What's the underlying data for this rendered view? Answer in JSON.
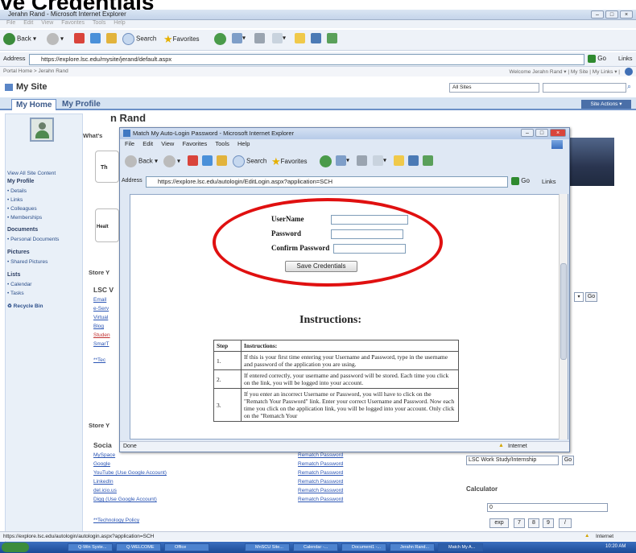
{
  "slide": {
    "title": "ve Credentials"
  },
  "main_window": {
    "title": "Jerahn Rand - Microsoft Internet Explorer",
    "menu": [
      "File",
      "Edit",
      "View",
      "Favorites",
      "Tools",
      "Help"
    ],
    "toolbar": {
      "back": "Back",
      "search": "Search",
      "favorites": "Favorites"
    },
    "address_label": "Address",
    "address": "https://explore.lsc.edu/mysite/jerand/default.aspx",
    "go": "Go",
    "links": "Links",
    "breadcrumb": "Portal Home > Jerahn Rand",
    "welcome": "Welcome Jerahn Rand ▾ | My Site | My Links ▾ |",
    "site_title": "My Site",
    "scope": "All Sites",
    "tabs": [
      "My Home",
      "My Profile"
    ],
    "site_actions": "Site Actions ▾",
    "status_url": "https://explore.lsc.edu/autologin/autologin.aspx?application=SCH",
    "status_zone": "Internet"
  },
  "left_nav": {
    "view_all": "View All Site Content",
    "sections": [
      {
        "heading": "My Profile",
        "items": [
          "Details",
          "Links",
          "Colleagues",
          "Memberships"
        ]
      },
      {
        "heading": "Documents",
        "items": [
          "Personal Documents"
        ]
      },
      {
        "heading": "Pictures",
        "items": [
          "Shared Pictures"
        ]
      },
      {
        "heading": "Lists",
        "items": [
          "Calendar",
          "Tasks"
        ]
      }
    ],
    "recycle_bin": "Recycle Bin"
  },
  "center": {
    "name_partial": "n Rand",
    "whats": "What's",
    "store1": "Store Y",
    "lsc": "LSC V",
    "links_partial": [
      "Email",
      "e-Serv",
      "Virtual",
      "Blog",
      "Studen",
      "SmarT"
    ],
    "tech_partial": "**Tec",
    "store2": "Store Y",
    "social": "Socia",
    "social_links": [
      "MySpace",
      "Google",
      "YouTube (Use Google Account)",
      "LinkedIn",
      "del.icio.us",
      "Digg (Use Google Account)"
    ],
    "rematch_links": [
      "Rematch Password",
      "Rematch Password",
      "Rematch Password",
      "Rematch Password",
      "Rematch Password",
      "Rematch Password"
    ],
    "tech_policy": "**Technology Policy",
    "th_partial": "Th",
    "healt_partial": "Healt"
  },
  "right": {
    "go1": "Go",
    "work_study": "LSC Work Study/Internship",
    "go2": "Go",
    "calculator": "Calculator",
    "calc_value": "0",
    "calc_buttons": [
      "exp",
      "7",
      "8",
      "9",
      "/"
    ]
  },
  "popup": {
    "title": "Match My Auto-Login Password - Microsoft Internet Explorer",
    "menu": [
      "File",
      "Edit",
      "View",
      "Favorites",
      "Tools",
      "Help"
    ],
    "toolbar": {
      "back": "Back",
      "search": "Search",
      "favorites": "Favorites"
    },
    "address_label": "Address",
    "address": "https://explore.lsc.edu/autologin/EditLogin.aspx?application=SCH",
    "go": "Go",
    "links": "Links",
    "form": {
      "username": "UserName",
      "password": "Password",
      "confirm": "Confirm Password",
      "save": "Save Credentials"
    },
    "instructions_title": "Instructions:",
    "table": {
      "headers": [
        "Step",
        "Instructions:"
      ],
      "rows": [
        {
          "step": "1.",
          "text": "If this is your first time entering your Username and Password, type in the username and password of the application you are using."
        },
        {
          "step": "2.",
          "text": "If entered correctly, your username and password will be stored.  Each time you click on the link, you will be logged into your account."
        },
        {
          "step": "3.",
          "text": "If you enter an incorrect Username or Password, you will have to click on the \"Rematch Your Password\" link.  Enter your correct Username and Password.  Now each time you click on the application link, you will be logged into your account.  Only click on the \"Rematch Your"
        }
      ]
    },
    "status": "Done",
    "zone": "Internet"
  },
  "taskbar": {
    "items": [
      "Q-Win Syste...",
      "Q-WELCOME",
      "Office",
      "MnSCU Site...",
      "Calendar -...",
      "Document1 -...",
      "Jerahn Rand...",
      "Match My A..."
    ],
    "clock": "10:20 AM"
  },
  "colors": {
    "accent": "#2c4f8a",
    "oval": "#e01010",
    "link": "#2b55b4"
  }
}
